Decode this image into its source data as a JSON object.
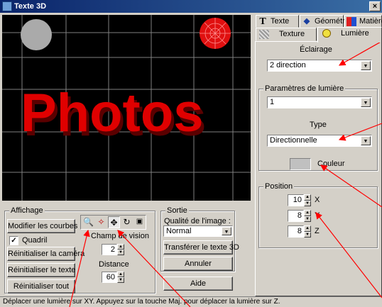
{
  "window": {
    "title": "Texte 3D",
    "close_glyph": "×"
  },
  "viewport": {
    "text": "Photos",
    "text_color": "#e00000",
    "background": "#000000"
  },
  "affichage": {
    "legend": "Affichage",
    "modifier_courbes": "Modifier les courbes",
    "quadril_label": "Quadril",
    "quadril_checked": "✓",
    "reinit_camera": "Réinitialiser la caméra",
    "reinit_texte": "Réinitialiser le texte",
    "reinit_tout": "Réinitialiser tout",
    "champ_label": "Champ de vision",
    "champ_value": "2",
    "distance_label": "Distance",
    "distance_value": "60",
    "tool_icons": [
      "zoom-icon",
      "pan-icon",
      "move-icon",
      "rotate-icon",
      "light-icon"
    ]
  },
  "sortie": {
    "legend": "Sortie",
    "qualite_label": "Qualité de l'image :",
    "qualite_value": "Normal",
    "transferer": "Transférer le texte 3D",
    "annuler": "Annuler"
  },
  "aide": "Aide",
  "status": "Déplacer une lumière sur XY. Appuyez sur la touche Maj. pour déplacer la lumière sur Z.",
  "tabs": {
    "texte": "Texte",
    "geometrie": "Géométrie",
    "matiere": "Matière",
    "texture": "Texture",
    "lumiere": "Lumière"
  },
  "lumiere": {
    "eclairage_label": "Éclairage",
    "eclairage_value": "2 direction",
    "params_legend": "Paramètres de lumière",
    "param_value": "1",
    "type_label": "Type",
    "type_value": "Directionnelle",
    "couleur_label": "Couleur",
    "couleur_swatch": "#c0c0c0",
    "position_legend": "Position",
    "x_value": "10",
    "y_value": "8",
    "z_value": "8",
    "x_label": "X",
    "y_label": "Y",
    "z_label": "Z"
  },
  "annotation_color": "#ff0000"
}
